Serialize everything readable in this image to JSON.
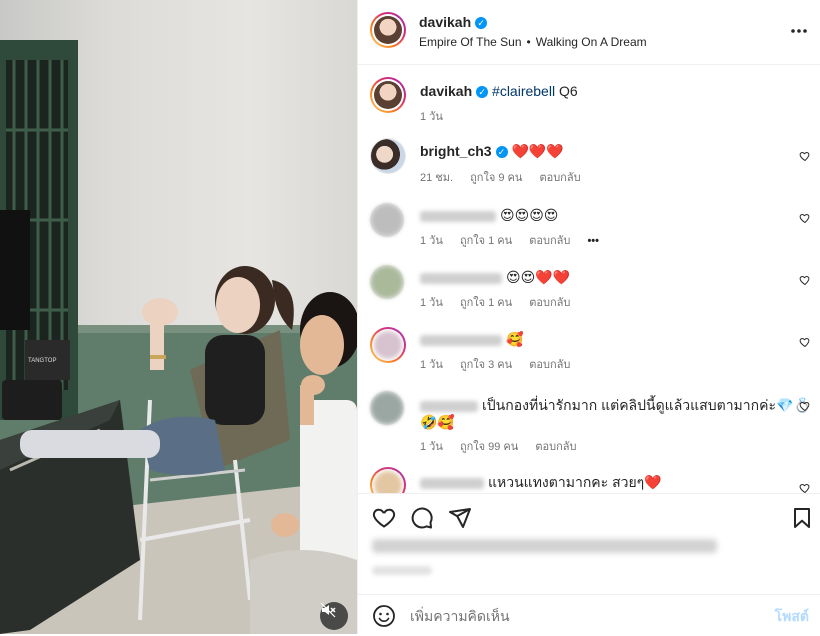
{
  "post": {
    "author": "davikah",
    "audio_artist": "Empire Of The Sun",
    "audio_track": "Walking On A Dream",
    "separator": "•",
    "more_icon": "more-horizontal-icon",
    "verified_color": "#0095f6"
  },
  "caption": {
    "author": "davikah",
    "hashtag": "#clairebell",
    "text": "Q6",
    "time": "1 วัน"
  },
  "comments": [
    {
      "author": "bright_ch3",
      "verified": true,
      "text": "❤️❤️❤️",
      "time": "21 ชม.",
      "likes": "ถูกใจ 9 คน",
      "reply": "ตอบกลับ"
    },
    {
      "author": "",
      "text": "😍😍😍😍",
      "time": "1 วัน",
      "likes": "ถูกใจ 1 คน",
      "reply": "ตอบกลับ",
      "options": "•••"
    },
    {
      "author": "",
      "text": "😍😍❤️❤️",
      "time": "1 วัน",
      "likes": "ถูกใจ 1 คน",
      "reply": "ตอบกลับ"
    },
    {
      "author": "",
      "text": "🥰",
      "time": "1 วัน",
      "likes": "ถูกใจ 3 คน",
      "reply": "ตอบกลับ"
    },
    {
      "author": "",
      "text": "เป็นกองที่น่ารักมาก แต่คลิปนี้ดูแล้วแสบตามากค่ะ💎💍",
      "text2": "🤣🥰",
      "time": "1 วัน",
      "likes": "ถูกใจ 99 คน",
      "reply": "ตอบกลับ"
    },
    {
      "author": "",
      "text": "แหวนแทงตามากคะ สวยๆ❤️"
    }
  ],
  "actions": {
    "like_icon": "heart-icon",
    "comment_icon": "comment-icon",
    "share_icon": "share-icon",
    "save_icon": "bookmark-icon"
  },
  "add_comment": {
    "placeholder": "เพิ่มความคิดเห็น",
    "post_label": "โพสต์",
    "emoji_icon": "emoji-icon"
  },
  "media": {
    "mute_icon": "speaker-muted-icon",
    "chair_text": "TANGTOP"
  },
  "colors": {
    "accent": "#0095f6",
    "post_disabled": "#b3dbff",
    "hashtag": "#00376b",
    "muted_text": "#737373"
  }
}
